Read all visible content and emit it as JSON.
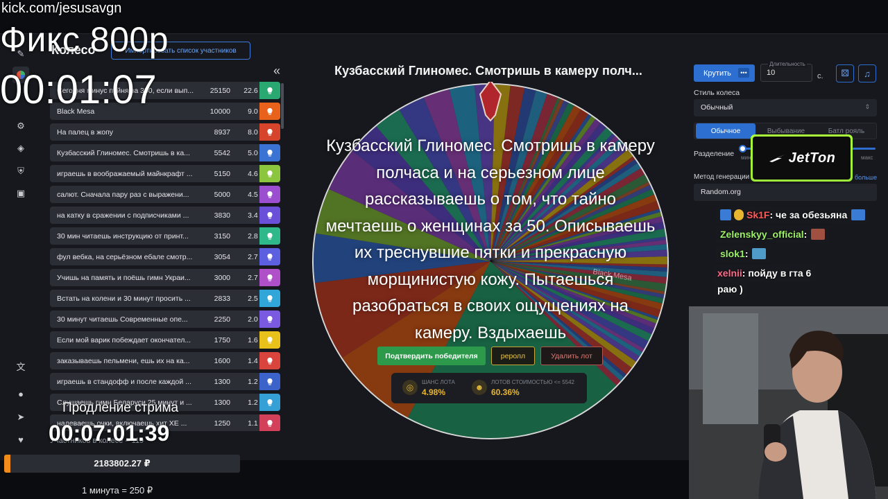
{
  "overlay": {
    "stream_url": "kick.com/jesusavgn",
    "fix_price": "Фикс 800р",
    "timer": "00:01:07",
    "extend_label": "Продление стрима",
    "extend_timer": "00:07:01:39",
    "rate": "1 минута = 250 ₽"
  },
  "panel": {
    "title": "Колесо",
    "import_button": "Импортировать список участников",
    "collapse": "«",
    "participants_count": "Участников в колесе – 119",
    "total": "2183802.27 ₽"
  },
  "lots": [
    {
      "name": "Сегодня минус пуйня за 350, если вып...",
      "amount": "25150",
      "percent": "22.6 %",
      "color": "#2aa872"
    },
    {
      "name": "Black Mesa",
      "amount": "10000",
      "percent": "9.0 %",
      "color": "#e8621c"
    },
    {
      "name": "На палец в жопу",
      "amount": "8937",
      "percent": "8.0 %",
      "color": "#d6452b"
    },
    {
      "name": "Кузбасский Глиномес. Смотришь в ка...",
      "amount": "5542",
      "percent": "5.0 %",
      "color": "#3a73d4"
    },
    {
      "name": "играешь в воображаемый майнкрафт ...",
      "amount": "5150",
      "percent": "4.6 %",
      "color": "#8cc63e"
    },
    {
      "name": "салют. Сначала пару раз с выражени...",
      "amount": "5000",
      "percent": "4.5 %",
      "color": "#9b4fd0"
    },
    {
      "name": "на катку в сражении с подписчиками ...",
      "amount": "3830",
      "percent": "3.4 %",
      "color": "#6a4fd8"
    },
    {
      "name": "30 мин читаешь инструкцию от принт...",
      "amount": "3150",
      "percent": "2.8 %",
      "color": "#2fb88a"
    },
    {
      "name": "фул вебка, на серьёзном ебале смотр...",
      "amount": "3054",
      "percent": "2.7 %",
      "color": "#5b5fe0"
    },
    {
      "name": "Учишь на память и поёшь гимн Украи...",
      "amount": "3000",
      "percent": "2.7 %",
      "color": "#b050c9"
    },
    {
      "name": "Встать на колени и 30 минут просить ...",
      "amount": "2833",
      "percent": "2.5 %",
      "color": "#31a7d9"
    },
    {
      "name": "30 минут читаешь Современные опе...",
      "amount": "2250",
      "percent": "2.0 %",
      "color": "#7a5ae0"
    },
    {
      "name": "Если мой варик побеждает окончател...",
      "amount": "1750",
      "percent": "1.6 %",
      "color": "#e8c21a"
    },
    {
      "name": "заказываешь пельмени, ешь их на ка...",
      "amount": "1600",
      "percent": "1.4 %",
      "color": "#d9453d"
    },
    {
      "name": "играешь в стандофф и после каждой ...",
      "amount": "1300",
      "percent": "1.2 %",
      "color": "#3b63c9"
    },
    {
      "name": "Слушаешь гимн Беларуси 25 минут и ...",
      "amount": "1300",
      "percent": "1.2 %",
      "color": "#34a0d6"
    },
    {
      "name": "надеваешь очки, включаешь хит ХЕ ...",
      "amount": "1250",
      "percent": "1.1 %",
      "color": "#d2405a"
    }
  ],
  "wheel": {
    "current_lot_title": "Кузбасский Глиномес. Смотришь в камеру полч...",
    "description": "Кузбасский Глиномес. Смотришь в камеру полчаса и на серьезном лице рассказываешь о том, что тайно мечтаешь о женщинах за 50. Описываешь их треснувшие пятки и прекрасную морщинистую кожу. Пытаешься разобраться в своих ощущениях на камеру. Вздыхаешь",
    "segment_label_black_mesa": "Black Mesa",
    "confirm_button": "Подтвердить победителя",
    "reroll_button": "реролл",
    "delete_button": "Удалить лот",
    "stat1_label": "ШАНС ЛОТА",
    "stat1_value": "4.98%",
    "stat2_label": "ЛОТОВ СТОИМОСТЬЮ <= 5542",
    "stat2_value": "60.36%"
  },
  "settings": {
    "spin_button": "Крутить",
    "duration_label": "Длительность",
    "duration_value": "10",
    "duration_unit": "с.",
    "style_label": "Стиль колеса",
    "style_value": "Обычный",
    "tabs": [
      "Обычное",
      "Выбывание",
      "Батл рояль"
    ],
    "split_label": "Разделение",
    "min_label": "мин",
    "max_label": "макс",
    "gen_label": "Метод генерации",
    "more_link": "больше",
    "gen_value": "Random.org",
    "sponsor": "JetTon"
  },
  "chat": {
    "messages": [
      {
        "user": "Sk1F",
        "text": ": че за обезьяна",
        "user_color": "#ff5a5a"
      },
      {
        "user": "Zelenskyy_official",
        "text": " :",
        "user_color": "#9ef26a"
      },
      {
        "user": "slok1",
        "text": " :",
        "user_color": "#9ef26a"
      },
      {
        "user": "xelnii",
        "text": " : пойду в гта 6",
        "user_color": "#ff6a8a"
      },
      {
        "user": "",
        "text": "раю )",
        "user_color": "#ffffff"
      }
    ]
  },
  "colors": {
    "accent": "#2d6fd1",
    "confirm": "#2c9a4a",
    "reroll": "#e8c84a",
    "delete": "#e27a73",
    "total_fill": "#f08c1a"
  }
}
